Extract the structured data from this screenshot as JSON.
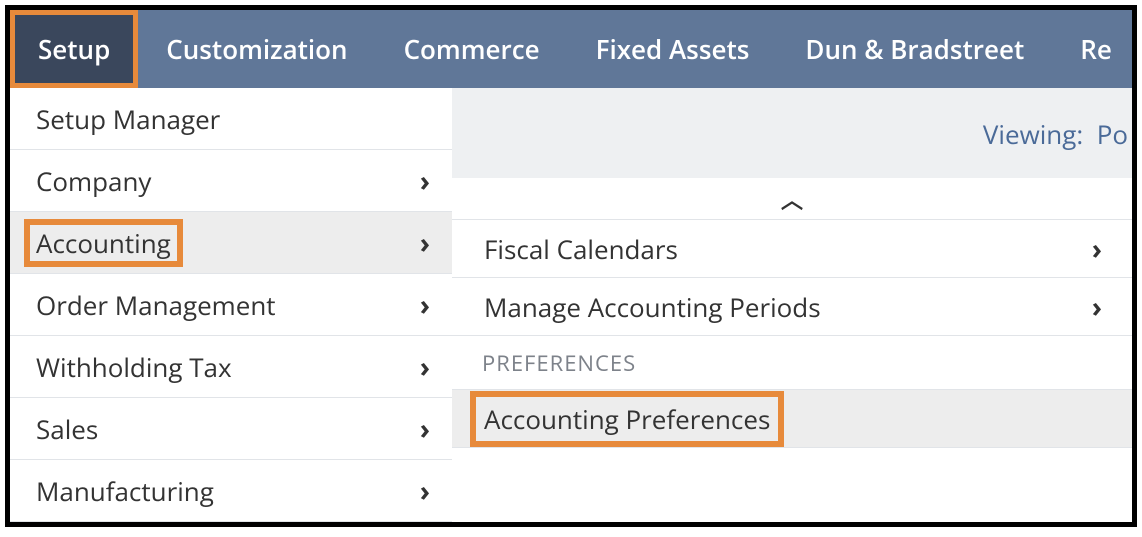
{
  "nav": {
    "items": [
      {
        "label": "Setup",
        "active": true
      },
      {
        "label": "Customization"
      },
      {
        "label": "Commerce"
      },
      {
        "label": "Fixed Assets"
      },
      {
        "label": "Dun & Bradstreet"
      },
      {
        "label": "Re"
      }
    ]
  },
  "subheader": {
    "viewing_prefix": "Viewing:",
    "viewing_value": "Po"
  },
  "menu1": {
    "items": [
      {
        "label": "Setup Manager",
        "has_sub": false
      },
      {
        "label": "Company",
        "has_sub": true
      },
      {
        "label": "Accounting",
        "has_sub": true,
        "hover": true,
        "highlight": true
      },
      {
        "label": "Order Management",
        "has_sub": true
      },
      {
        "label": "Withholding Tax",
        "has_sub": true
      },
      {
        "label": "Sales",
        "has_sub": true
      },
      {
        "label": "Manufacturing",
        "has_sub": true
      }
    ]
  },
  "menu2": {
    "scroll_up": true,
    "items": [
      {
        "label": "Fiscal Calendars",
        "has_sub": true
      },
      {
        "label": "Manage Accounting Periods",
        "has_sub": true
      }
    ],
    "section_header": "PREFERENCES",
    "pref_items": [
      {
        "label": "Accounting Preferences",
        "hover": true,
        "highlight": true
      }
    ]
  }
}
